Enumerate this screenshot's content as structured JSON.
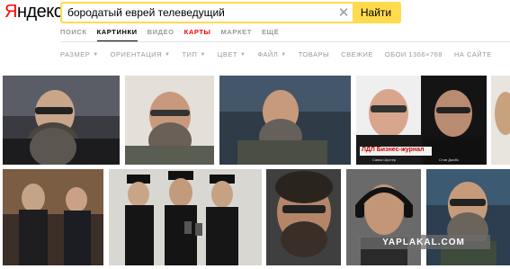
{
  "logo": {
    "first": "Я",
    "rest": "ндекс"
  },
  "search": {
    "value": "бородатый еврей телеведущий",
    "button_label": "Найти",
    "clear_icon": "close-icon"
  },
  "tabs": [
    {
      "label": "ПОИСК"
    },
    {
      "label": "КАРТИНКИ",
      "active": true
    },
    {
      "label": "ВИДЕО"
    },
    {
      "label": "КАРТЫ"
    },
    {
      "label": "МАРКЕТ"
    },
    {
      "label": "ЕЩЁ"
    }
  ],
  "filters": [
    {
      "label": "РАЗМЕР",
      "dropdown": true
    },
    {
      "label": "ОРИЕНТАЦИЯ",
      "dropdown": true
    },
    {
      "label": "ТИП",
      "dropdown": true
    },
    {
      "label": "ЦВЕТ",
      "dropdown": true
    },
    {
      "label": "ФАЙЛ",
      "dropdown": true
    },
    {
      "label": "ТОВАРЫ",
      "dropdown": false
    },
    {
      "label": "СВЕЖИЕ",
      "dropdown": false
    },
    {
      "label": "ОБОИ 1366×768",
      "dropdown": false
    },
    {
      "label": "НА САЙТЕ",
      "dropdown": false
    }
  ],
  "images": {
    "caption_brand": "ЛДЛ Бизнес-журнал",
    "caption_left": "Савик Шустер",
    "caption_right": "Стив Джобс",
    "watermark": "YAPLAKAL.COM"
  },
  "colors": {
    "accent": "#ffdb4d",
    "logo_red": "#ff0000",
    "maps_red": "#ff0000"
  }
}
